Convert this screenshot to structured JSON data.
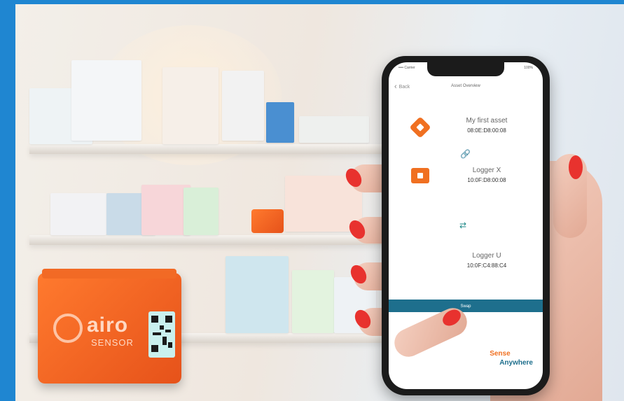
{
  "phone": {
    "status": {
      "carrier": "•••• Carrier",
      "battery": "100%"
    },
    "nav": {
      "back_label": "Back",
      "title": "Asset Overview"
    },
    "assets": [
      {
        "name": "My first asset",
        "mac": "08:0E:D8:00:08",
        "icon": "asset-tag-icon"
      },
      {
        "name": "Logger X",
        "mac": "10:0F:D8:00:08",
        "icon": "logger-box-icon"
      },
      {
        "name": "Logger U",
        "mac": "10:0F:C4:88:C4",
        "icon": "none"
      }
    ],
    "link_icon": "link-icon",
    "swap_icon": "swap-arrows-icon",
    "swap_button_label": "Swap",
    "brand_line1": "Sense",
    "brand_line2": "Anywhere"
  },
  "sensor": {
    "brand": "airo",
    "sub": "SENSOR"
  },
  "colors": {
    "frame": "#1f86d1",
    "accent": "#f07021",
    "button": "#1e6f8d"
  }
}
